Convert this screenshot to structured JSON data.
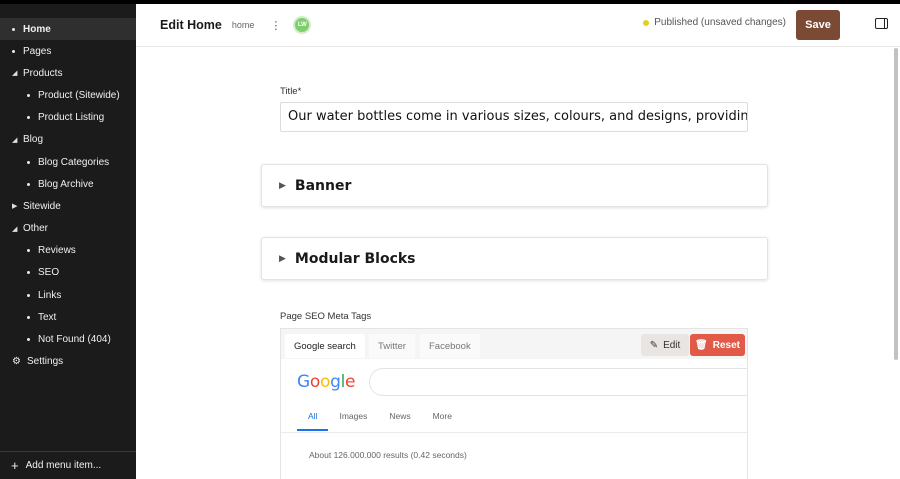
{
  "sidebar": {
    "items": [
      {
        "label": "Home",
        "level": 0,
        "marker": "bullet",
        "active": true
      },
      {
        "label": "Pages",
        "level": 0,
        "marker": "bullet"
      },
      {
        "label": "Products",
        "level": 0,
        "marker": "expanded"
      },
      {
        "label": "Product (Sitewide)",
        "level": 1,
        "marker": "bullet"
      },
      {
        "label": "Product Listing",
        "level": 1,
        "marker": "bullet"
      },
      {
        "label": "Blog",
        "level": 0,
        "marker": "expanded"
      },
      {
        "label": "Blog Categories",
        "level": 1,
        "marker": "bullet"
      },
      {
        "label": "Blog Archive",
        "level": 1,
        "marker": "bullet"
      },
      {
        "label": "Sitewide",
        "level": 0,
        "marker": "collapsed"
      },
      {
        "label": "Other",
        "level": 0,
        "marker": "expanded"
      },
      {
        "label": "Reviews",
        "level": 1,
        "marker": "bullet"
      },
      {
        "label": "SEO",
        "level": 1,
        "marker": "bullet"
      },
      {
        "label": "Links",
        "level": 1,
        "marker": "bullet"
      },
      {
        "label": "Text",
        "level": 1,
        "marker": "bullet"
      },
      {
        "label": "Not Found (404)",
        "level": 1,
        "marker": "bullet"
      },
      {
        "label": "Settings",
        "level": 0,
        "marker": "gear"
      }
    ],
    "footer_label": "Add menu item..."
  },
  "header": {
    "title": "Edit Home",
    "slug": "home",
    "kebab": "⋮",
    "avatar_initials": "LW",
    "status": "Published (unsaved changes)",
    "save_label": "Save"
  },
  "form": {
    "title_label": "Title*",
    "title_value": "Our water bottles come in various sizes, colours, and designs, providing",
    "accordions": [
      "Banner",
      "Modular Blocks"
    ],
    "seo_label": "Page SEO Meta Tags"
  },
  "seo": {
    "tabs": [
      "Google search",
      "Twitter",
      "Facebook"
    ],
    "active_tab": "Google search",
    "edit_label": "Edit",
    "reset_label": "Reset",
    "google_logo": [
      "G",
      "o",
      "o",
      "g",
      "l",
      "e"
    ],
    "google_tabs": [
      "All",
      "Images",
      "News",
      "More"
    ],
    "results_text": "About 126.000.000 results (0.42 seconds)"
  },
  "colors": {
    "sidebar_bg": "#1b1b1b",
    "save_button": "#7a4a34",
    "reset_button": "#e05a47",
    "status_dot": "#e1d21c",
    "avatar": "#7dcf6c",
    "google_blue": "#4285f4",
    "google_red": "#ea4335",
    "google_yellow": "#fbbc05",
    "google_green": "#34a853"
  }
}
